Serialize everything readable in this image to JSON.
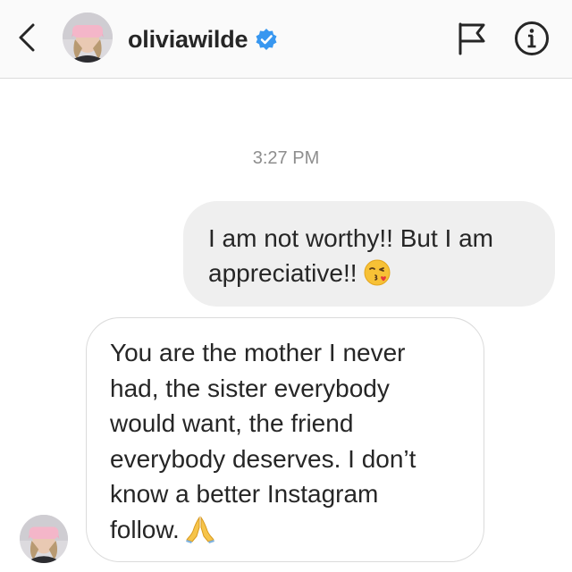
{
  "header": {
    "username": "oliviawilde",
    "verified": true,
    "icons": [
      "back-chevron-icon",
      "avatar",
      "verified-badge-icon",
      "flag-icon",
      "info-icon"
    ],
    "accent_color": "#3897f0"
  },
  "thread": {
    "timestamp": "3:27 PM",
    "messages": [
      {
        "direction": "sent",
        "lines": [
          "I am not worthy!! But I am",
          "appreciative!!"
        ],
        "emoji": "😘"
      },
      {
        "direction": "received",
        "lines": [
          "You are the mother I never",
          "had, the sister everybody",
          "would want, the friend",
          "everybody deserves. I don’t",
          "know a better Instagram",
          "follow."
        ],
        "emoji": "🙏"
      }
    ]
  }
}
